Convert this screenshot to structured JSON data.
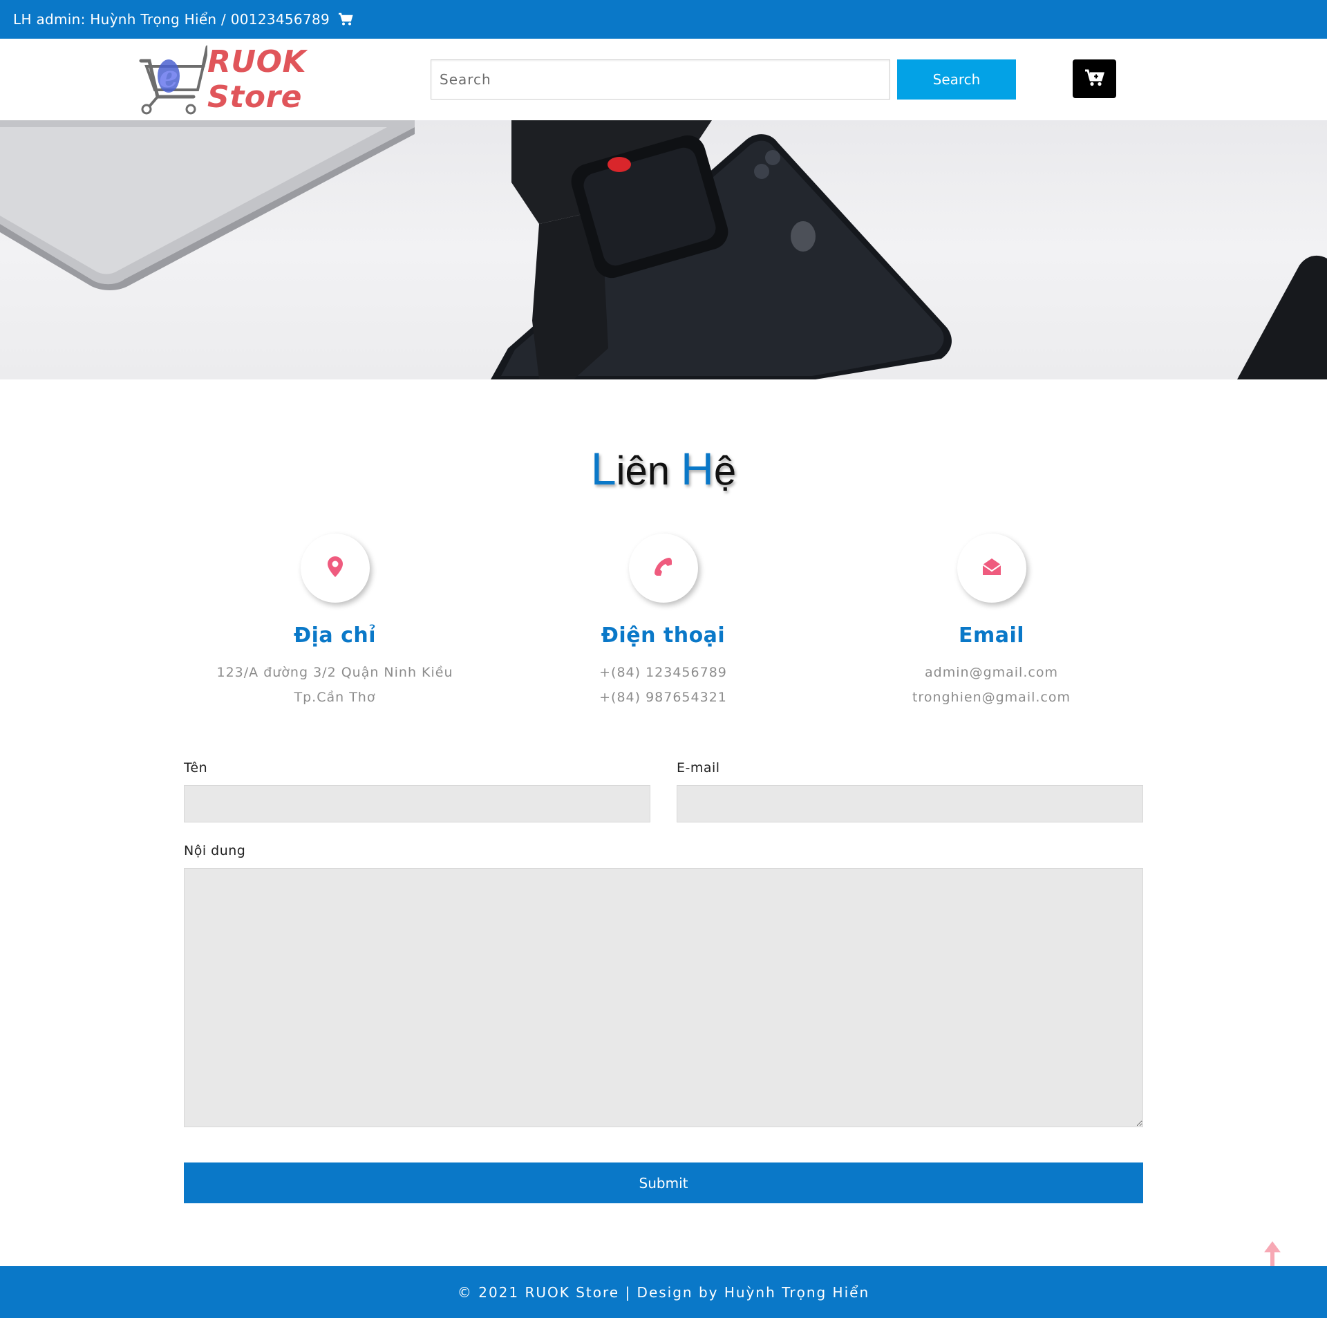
{
  "topbar": {
    "text": "LH admin: Huỳnh Trọng Hiển / 00123456789",
    "icon": "cart-icon"
  },
  "header": {
    "logo_text": "RUOK Store",
    "search_placeholder": "Search",
    "search_button": "Search",
    "cart_icon": "cart-plus-icon"
  },
  "colors": {
    "primary": "#0a78c8",
    "search_button": "#03a2e6",
    "accent_icon": "#ef5b7e",
    "logo_text": "#e0555a"
  },
  "title": {
    "first_cap": "L",
    "first_rest": "iên ",
    "second_cap": "H",
    "second_rest": "ệ"
  },
  "info": [
    {
      "icon": "map-marker-icon",
      "heading": "Địa chỉ",
      "lines": [
        "123/A đường 3/2 Quận Ninh Kiều",
        "Tp.Cần Thơ"
      ]
    },
    {
      "icon": "phone-icon",
      "heading": "Điện thoại",
      "lines": [
        "+(84) 123456789",
        "+(84) 987654321"
      ]
    },
    {
      "icon": "envelope-open-icon",
      "heading": "Email",
      "lines": [
        "admin@gmail.com",
        "tronghien@gmail.com"
      ]
    }
  ],
  "form": {
    "name_label": "Tên",
    "email_label": "E-mail",
    "content_label": "Nội dung",
    "submit_label": "Submit"
  },
  "footer": {
    "text": "© 2021 RUOK Store | Design by Huỳnh Trọng Hiển"
  }
}
